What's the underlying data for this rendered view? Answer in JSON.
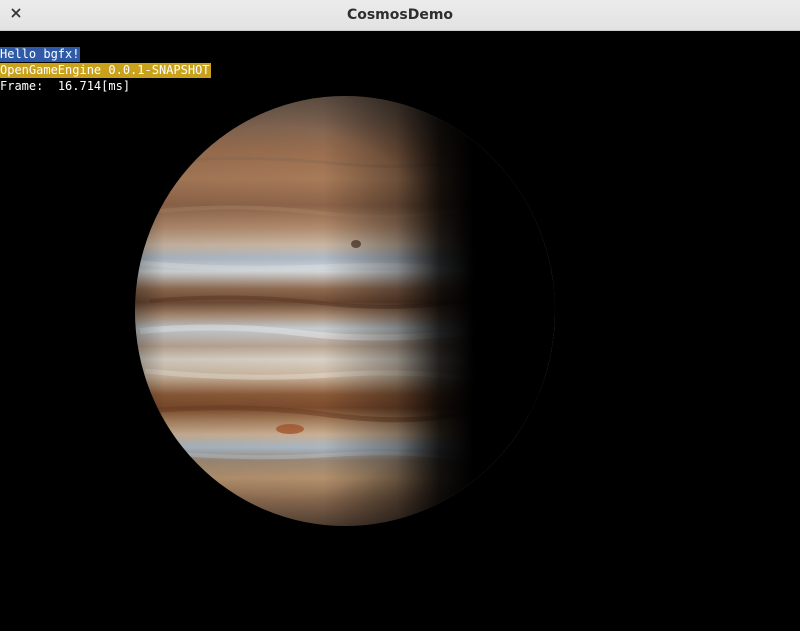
{
  "window": {
    "title": "CosmosDemo",
    "close_glyph": "✕"
  },
  "overlay": {
    "hello": "Hello bgfx!",
    "engine": "OpenGameEngine 0.0.1-SNAPSHOT",
    "frame_label": "Frame:",
    "frame_value": "16.714",
    "frame_unit": "[ms]"
  },
  "colors": {
    "hello_bg": "#2f5aa8",
    "engine_bg": "#c9a11a"
  },
  "scene": {
    "object": "planet-jupiter"
  }
}
